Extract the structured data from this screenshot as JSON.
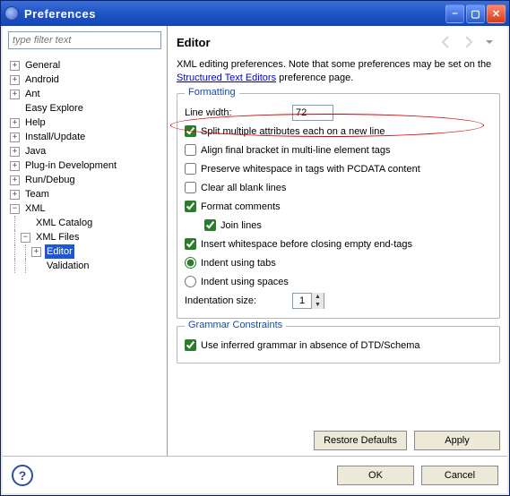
{
  "window": {
    "title": "Preferences"
  },
  "filter": {
    "placeholder": "type filter text"
  },
  "tree": {
    "items": [
      {
        "label": "General",
        "twist": "+"
      },
      {
        "label": "Android",
        "twist": "+"
      },
      {
        "label": "Ant",
        "twist": "+"
      },
      {
        "label": "Easy Explore",
        "twist": ""
      },
      {
        "label": "Help",
        "twist": "+"
      },
      {
        "label": "Install/Update",
        "twist": "+"
      },
      {
        "label": "Java",
        "twist": "+"
      },
      {
        "label": "Plug-in Development",
        "twist": "+"
      },
      {
        "label": "Run/Debug",
        "twist": "+"
      },
      {
        "label": "Team",
        "twist": "+"
      },
      {
        "label": "XML",
        "twist": "-"
      }
    ],
    "xml": {
      "catalog": "XML Catalog",
      "files": "XML Files",
      "editor": "Editor",
      "validation": "Validation"
    }
  },
  "page": {
    "title": "Editor",
    "desc1": "XML editing preferences.  Note that some preferences may be set on the ",
    "link": "Structured Text Editors",
    "desc2": " preference page."
  },
  "formatting": {
    "legend": "Formatting",
    "line_width_label": "Line width:",
    "line_width_value": "72",
    "split": "Split multiple attributes each on a new line",
    "align": "Align final bracket in multi-line element tags",
    "preserve": "Preserve whitespace in tags with PCDATA content",
    "clear": "Clear all blank lines",
    "format_comments": "Format comments",
    "join": "Join lines",
    "insert_ws": "Insert whitespace before closing empty end-tags",
    "indent_tabs": "Indent using tabs",
    "indent_spaces": "Indent using spaces",
    "indent_size_label": "Indentation size:",
    "indent_size_value": "1"
  },
  "grammar": {
    "legend": "Grammar Constraints",
    "inferred": "Use inferred grammar in absence of DTD/Schema"
  },
  "buttons": {
    "restore": "Restore Defaults",
    "apply": "Apply",
    "ok": "OK",
    "cancel": "Cancel"
  }
}
